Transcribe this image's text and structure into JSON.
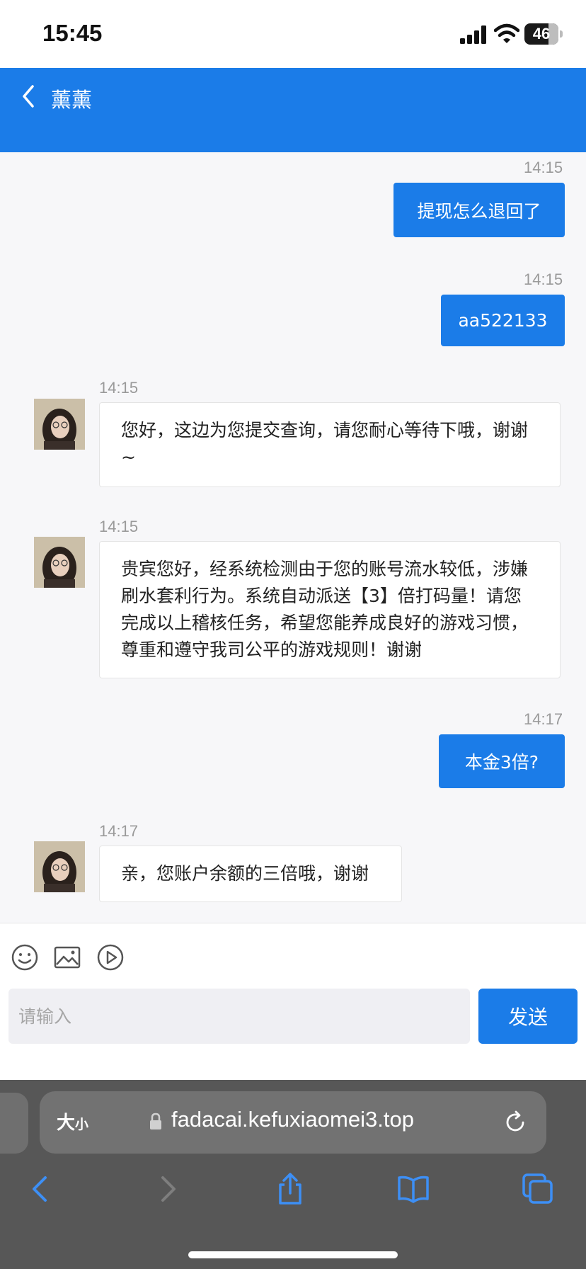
{
  "status_bar": {
    "time": "15:45",
    "battery": "46"
  },
  "header": {
    "title": "薰薰"
  },
  "messages": [
    {
      "side": "right",
      "time": "14:15",
      "text": "提现怎么退回了"
    },
    {
      "side": "right",
      "time": "14:15",
      "text": "aa522133"
    },
    {
      "side": "left",
      "time": "14:15",
      "text": "您好，这边为您提交查询，请您耐心等待下哦，谢谢~"
    },
    {
      "side": "left",
      "time": "14:15",
      "text": "贵宾您好，经系统检测由于您的账号流水较低，涉嫌刷水套利行为。系统自动派送【3】倍打码量！请您完成以上稽核任务，希望您能养成良好的游戏习惯，尊重和遵守我司公平的游戏规则！谢谢"
    },
    {
      "side": "right",
      "time": "14:17",
      "text": "本金3倍?"
    },
    {
      "side": "left",
      "time": "14:17",
      "text": "亲，您账户余额的三倍哦，谢谢"
    }
  ],
  "input": {
    "placeholder": "请输入",
    "send_label": "发送"
  },
  "browser": {
    "text_size_big": "大",
    "text_size_small": "小",
    "url": "fadacai.kefuxiaomei3.top"
  },
  "colors": {
    "accent": "#1b7ce8"
  }
}
